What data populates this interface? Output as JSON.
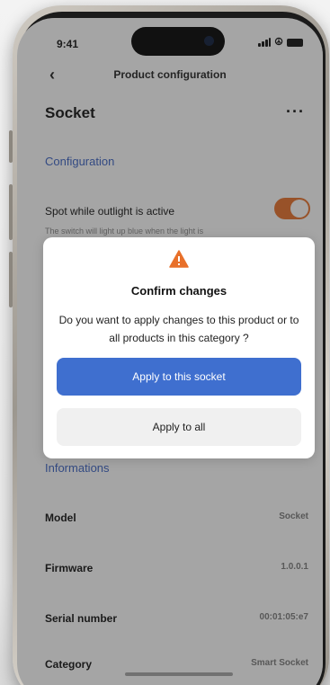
{
  "status_bar": {
    "time": "9:41"
  },
  "nav": {
    "back_icon": "chevron-left-icon",
    "title": "Product configuration"
  },
  "header": {
    "title": "Socket",
    "more_icon": "more-icon"
  },
  "configuration": {
    "section_title": "Configuration",
    "toggle_label": "Spot while outlight is active",
    "toggle_hint": "The switch will light up blue when the light is",
    "toggle_on": true
  },
  "dialog": {
    "icon": "warning-icon",
    "title": "Confirm changes",
    "message": "Do you want to apply changes to this product or to all products in this category ?",
    "primary_label": "Apply to this socket",
    "secondary_label": "Apply to all"
  },
  "informations": {
    "section_title": "Informations",
    "rows": [
      {
        "label": "Model",
        "value": "Socket"
      },
      {
        "label": "Firmware",
        "value": "1.0.0.1"
      },
      {
        "label": "Serial number",
        "value": "00:01:05:e7"
      },
      {
        "label": "Category",
        "value": "Smart Socket"
      }
    ]
  },
  "colors": {
    "accent": "#3f6fcf",
    "section": "#3b63c4",
    "toggle_on": "#e8702a",
    "warning": "#e8702a"
  }
}
